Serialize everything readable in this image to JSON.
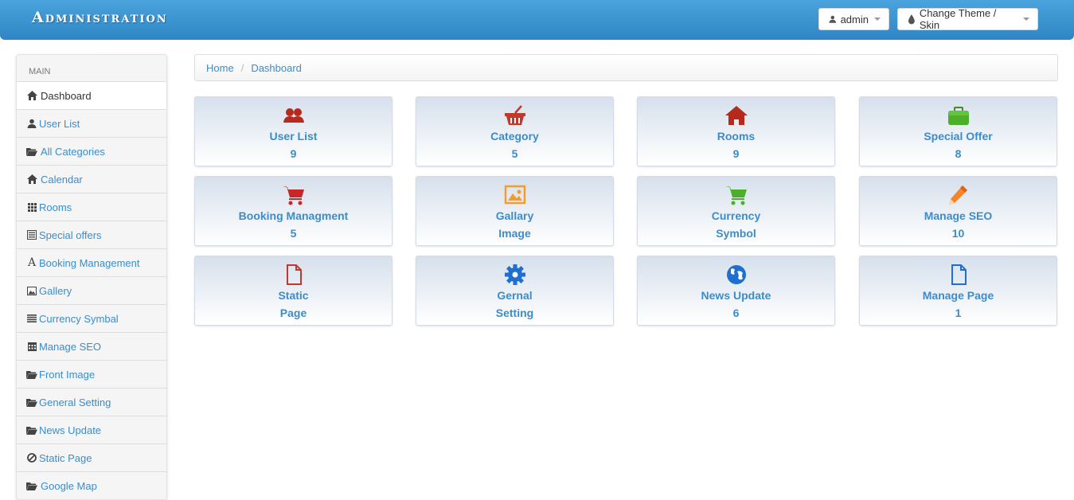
{
  "header": {
    "brand": "Administration",
    "user_label": "admin",
    "theme_label": "Change Theme / Skin"
  },
  "sidebar": {
    "section": "MAIN",
    "items": [
      {
        "label": "Dashboard",
        "icon": "home-icon"
      },
      {
        "label": "User List",
        "icon": "user-icon"
      },
      {
        "label": "All Categories",
        "icon": "folder-open-icon"
      },
      {
        "label": "Calendar",
        "icon": "home-icon"
      },
      {
        "label": "Rooms",
        "icon": "grid-icon"
      },
      {
        "label": "Special offers",
        "icon": "list-icon"
      },
      {
        "label": "Booking Management",
        "icon": "font-icon"
      },
      {
        "label": "Gallery",
        "icon": "picture-icon"
      },
      {
        "label": "Currency Symbal",
        "icon": "align-justify-icon"
      },
      {
        "label": "Manage SEO",
        "icon": "calendar-icon"
      },
      {
        "label": "Front Image",
        "icon": "folder-open-icon"
      },
      {
        "label": "General Setting",
        "icon": "folder-open-icon"
      },
      {
        "label": "News Update",
        "icon": "folder-open-icon"
      },
      {
        "label": "Static Page",
        "icon": "ban-icon"
      },
      {
        "label": "Google Map",
        "icon": "folder-open-icon"
      }
    ]
  },
  "breadcrumb": {
    "home": "Home",
    "separator": "/",
    "current": "Dashboard"
  },
  "tiles": [
    {
      "label": "User List",
      "value": "9",
      "icon": "users-icon",
      "color": "#b52a1c"
    },
    {
      "label": "Category",
      "value": "5",
      "icon": "basket-icon",
      "color": "#c0392b"
    },
    {
      "label": "Rooms",
      "value": "9",
      "icon": "home-icon",
      "color": "#b52a1c"
    },
    {
      "label": "Special Offer",
      "value": "8",
      "icon": "briefcase-icon",
      "color": "#4caf2a"
    },
    {
      "label": "Booking Managment",
      "value": "5",
      "icon": "cart-icon",
      "color": "#c62828"
    },
    {
      "label": "Gallary",
      "value": "Image",
      "icon": "picture-icon",
      "color": "#f59c2a"
    },
    {
      "label": "Currency",
      "value": "Symbol",
      "icon": "cart-icon",
      "color": "#4caf2a"
    },
    {
      "label": "Manage SEO",
      "value": "10",
      "icon": "pencil-icon",
      "color": "#f5842a"
    },
    {
      "label": "Static",
      "value": "Page",
      "icon": "document-icon",
      "color": "#c0392b"
    },
    {
      "label": "Gernal",
      "value": "Setting",
      "icon": "gear-icon",
      "color": "#1e6fd0"
    },
    {
      "label": "News Update",
      "value": "6",
      "icon": "globe-icon",
      "color": "#1e6fd0"
    },
    {
      "label": "Manage Page",
      "value": "1",
      "icon": "document-icon",
      "color": "#1e6fd0"
    }
  ]
}
